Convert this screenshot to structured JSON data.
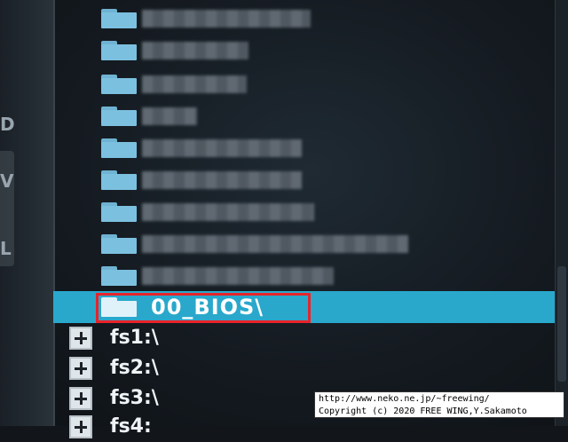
{
  "tree": {
    "selected": {
      "label": "00_BIOS\\"
    },
    "drives": [
      {
        "label": "fs1:\\"
      },
      {
        "label": "fs2:\\"
      },
      {
        "label": "fs3:\\"
      },
      {
        "label": "fs4:"
      }
    ]
  },
  "left_panel": {
    "letters": [
      "D",
      "V",
      "L"
    ]
  },
  "watermark": {
    "line1": "http://www.neko.ne.jp/~freewing/",
    "line2": "Copyright (c) 2020 FREE WING,Y.Sakamoto"
  },
  "colors": {
    "selection": "#2aa8cc",
    "folder": "#7cc0df",
    "highlight_box": "#e8232a"
  }
}
